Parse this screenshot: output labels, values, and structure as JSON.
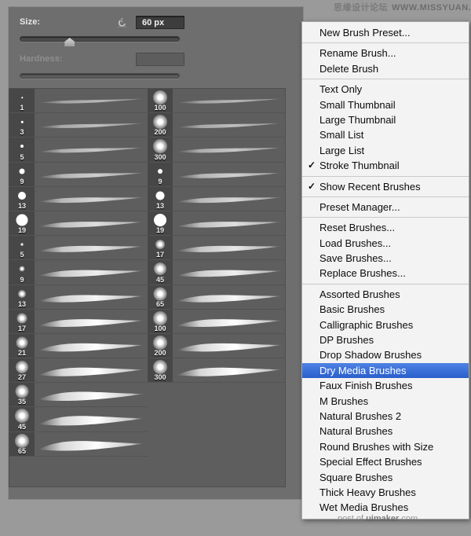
{
  "panel": {
    "size": {
      "label": "Size:",
      "value": "60 px",
      "reset_icon": "reset-arrow-icon",
      "slider_percent": 31
    },
    "hardness": {
      "label": "Hardness:",
      "value": "",
      "disabled": true,
      "slider_percent": 0
    }
  },
  "brush_list": {
    "column1": [
      {
        "size": "1",
        "dot": 1.5,
        "hard": true
      },
      {
        "size": "3",
        "dot": 2.5,
        "hard": true
      },
      {
        "size": "5",
        "dot": 4,
        "hard": true
      },
      {
        "size": "9",
        "dot": 7,
        "hard": true
      },
      {
        "size": "13",
        "dot": 10,
        "hard": true
      },
      {
        "size": "19",
        "dot": 15,
        "hard": true
      },
      {
        "size": "5",
        "dot": 4,
        "hard": false
      },
      {
        "size": "9",
        "dot": 7,
        "hard": false
      },
      {
        "size": "13",
        "dot": 10,
        "hard": false
      },
      {
        "size": "17",
        "dot": 13,
        "hard": false
      },
      {
        "size": "21",
        "dot": 15,
        "hard": false
      },
      {
        "size": "27",
        "dot": 16,
        "hard": false
      },
      {
        "size": "35",
        "dot": 17,
        "hard": false
      },
      {
        "size": "45",
        "dot": 18,
        "hard": false
      },
      {
        "size": "65",
        "dot": 18,
        "hard": false
      }
    ],
    "column2": [
      {
        "size": "100",
        "dot": 18,
        "hard": false
      },
      {
        "size": "200",
        "dot": 18,
        "hard": false
      },
      {
        "size": "300",
        "dot": 18,
        "hard": false
      },
      {
        "size": "9",
        "dot": 6,
        "hard": true
      },
      {
        "size": "13",
        "dot": 11,
        "hard": true
      },
      {
        "size": "19",
        "dot": 16,
        "hard": true
      },
      {
        "size": "17",
        "dot": 12,
        "hard": false
      },
      {
        "size": "45",
        "dot": 16,
        "hard": false
      },
      {
        "size": "65",
        "dot": 17,
        "hard": false
      },
      {
        "size": "100",
        "dot": 18,
        "hard": false
      },
      {
        "size": "200",
        "dot": 18,
        "hard": false
      },
      {
        "size": "300",
        "dot": 18,
        "hard": false
      }
    ]
  },
  "menu": {
    "groups": [
      [
        {
          "label": "New Brush Preset...",
          "checked": false,
          "selected": false
        }
      ],
      [
        {
          "label": "Rename Brush...",
          "checked": false,
          "selected": false
        },
        {
          "label": "Delete Brush",
          "checked": false,
          "selected": false
        }
      ],
      [
        {
          "label": "Text Only",
          "checked": false,
          "selected": false
        },
        {
          "label": "Small Thumbnail",
          "checked": false,
          "selected": false
        },
        {
          "label": "Large Thumbnail",
          "checked": false,
          "selected": false
        },
        {
          "label": "Small List",
          "checked": false,
          "selected": false
        },
        {
          "label": "Large List",
          "checked": false,
          "selected": false
        },
        {
          "label": "Stroke Thumbnail",
          "checked": true,
          "selected": false
        }
      ],
      [
        {
          "label": "Show Recent Brushes",
          "checked": true,
          "selected": false
        }
      ],
      [
        {
          "label": "Preset Manager...",
          "checked": false,
          "selected": false
        }
      ],
      [
        {
          "label": "Reset Brushes...",
          "checked": false,
          "selected": false
        },
        {
          "label": "Load Brushes...",
          "checked": false,
          "selected": false
        },
        {
          "label": "Save Brushes...",
          "checked": false,
          "selected": false
        },
        {
          "label": "Replace Brushes...",
          "checked": false,
          "selected": false
        }
      ],
      [
        {
          "label": "Assorted Brushes",
          "checked": false,
          "selected": false
        },
        {
          "label": "Basic Brushes",
          "checked": false,
          "selected": false
        },
        {
          "label": "Calligraphic Brushes",
          "checked": false,
          "selected": false
        },
        {
          "label": "DP Brushes",
          "checked": false,
          "selected": false
        },
        {
          "label": "Drop Shadow Brushes",
          "checked": false,
          "selected": false
        },
        {
          "label": "Dry Media Brushes",
          "checked": false,
          "selected": true
        },
        {
          "label": "Faux Finish Brushes",
          "checked": false,
          "selected": false
        },
        {
          "label": "M Brushes",
          "checked": false,
          "selected": false
        },
        {
          "label": "Natural Brushes 2",
          "checked": false,
          "selected": false
        },
        {
          "label": "Natural Brushes",
          "checked": false,
          "selected": false
        },
        {
          "label": "Round Brushes with Size",
          "checked": false,
          "selected": false
        },
        {
          "label": "Special Effect Brushes",
          "checked": false,
          "selected": false
        },
        {
          "label": "Square Brushes",
          "checked": false,
          "selected": false
        },
        {
          "label": "Thick Heavy Brushes",
          "checked": false,
          "selected": false
        },
        {
          "label": "Wet Media Brushes",
          "checked": false,
          "selected": false
        }
      ]
    ],
    "check_glyph": "✓",
    "highlight_color": "#2a5fcc"
  },
  "watermarks": {
    "top_cn": "思缘设计论坛",
    "top_url": "WWW.MISSYUAN.COM",
    "bottom_prefix": "post of ",
    "bottom_brand": "uimaker",
    "bottom_suffix": ".com"
  }
}
